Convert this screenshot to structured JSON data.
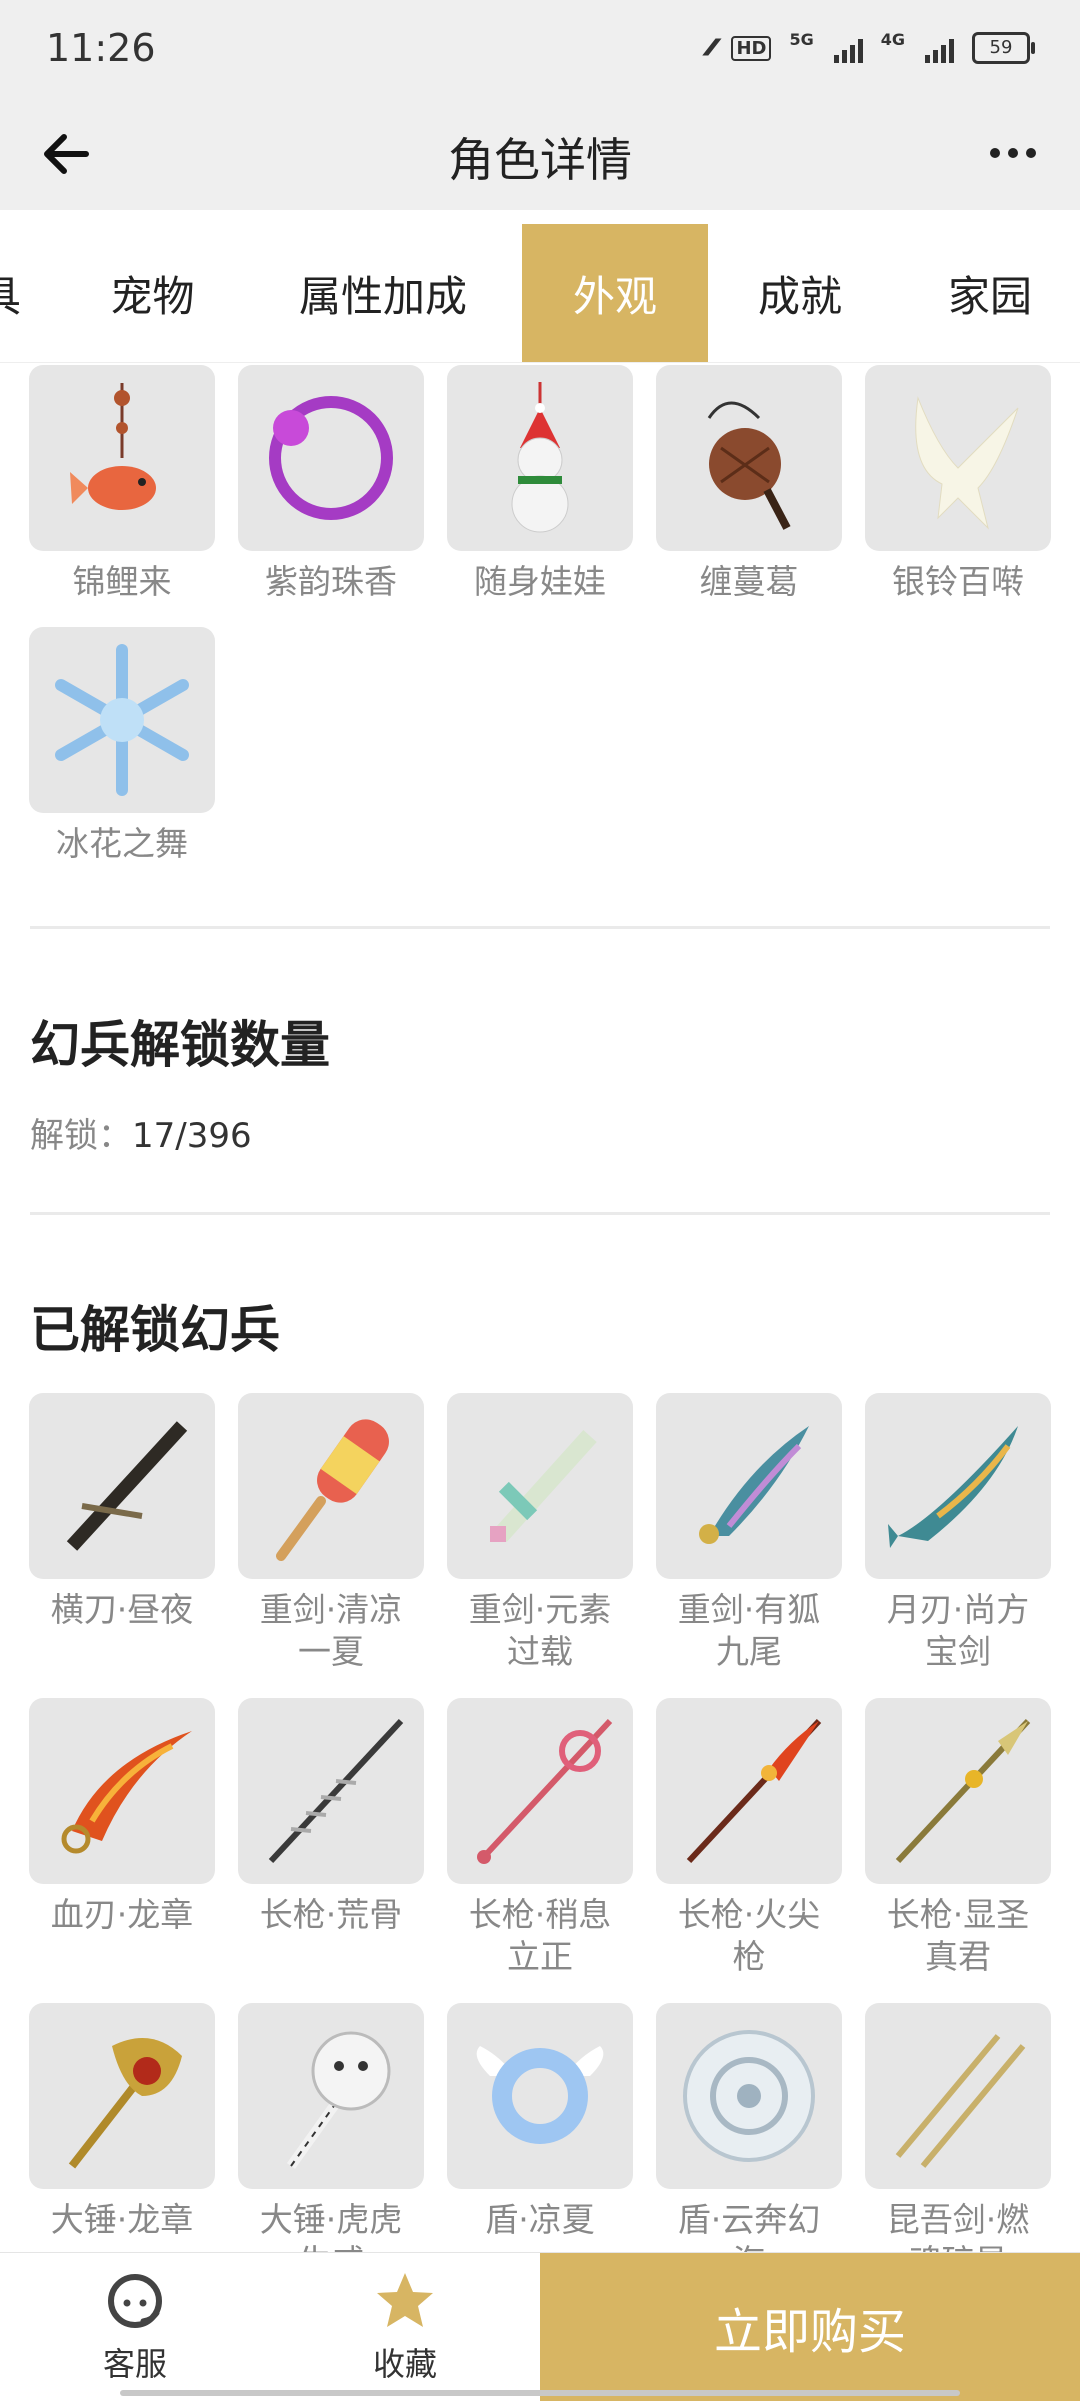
{
  "status": {
    "time": "11:26",
    "battery": "59",
    "net1": "5G",
    "net2": "4G",
    "hd": "HD"
  },
  "header": {
    "title": "角色详情"
  },
  "tabs": [
    {
      "label": "具",
      "active": false
    },
    {
      "label": "宠物",
      "active": false
    },
    {
      "label": "属性加成",
      "active": false
    },
    {
      "label": "外观",
      "active": true
    },
    {
      "label": "成就",
      "active": false
    },
    {
      "label": "家园",
      "active": false
    }
  ],
  "appearance_items": [
    {
      "name": "锦鲤来",
      "icon": "koi-pendant-icon"
    },
    {
      "name": "紫韵珠香",
      "icon": "purple-ring-icon"
    },
    {
      "name": "随身娃娃",
      "icon": "snowman-doll-icon"
    },
    {
      "name": "缠蔓葛",
      "icon": "gourd-icon"
    },
    {
      "name": "银铃百啭",
      "icon": "white-bird-icon"
    },
    {
      "name": "冰花之舞",
      "icon": "snowflake-icon"
    }
  ],
  "unlock_section": {
    "title": "幻兵解锁数量",
    "label": "解锁：",
    "value": "17/396"
  },
  "weapons_section": {
    "title": "已解锁幻兵"
  },
  "weapons": [
    {
      "line1": "横刀·昼夜",
      "line2": "",
      "icon": "dark-blade-icon"
    },
    {
      "line1": "重剑·清凉",
      "line2": "一夏",
      "icon": "popsicle-sword-icon"
    },
    {
      "line1": "重剑·元素",
      "line2": "过载",
      "icon": "pixel-sword-icon"
    },
    {
      "line1": "重剑·有狐",
      "line2": "九尾",
      "icon": "fox-tail-sword-icon"
    },
    {
      "line1": "月刃·尚方",
      "line2": "宝剑",
      "icon": "fish-blade-icon"
    },
    {
      "line1": "血刃·龙章",
      "line2": "",
      "icon": "fire-blade-icon"
    },
    {
      "line1": "长枪·荒骨",
      "line2": "",
      "icon": "bone-spear-icon"
    },
    {
      "line1": "长枪·稍息",
      "line2": "立正",
      "icon": "candy-spear-icon"
    },
    {
      "line1": "长枪·火尖",
      "line2": "枪",
      "icon": "fire-spear-icon"
    },
    {
      "line1": "长枪·显圣",
      "line2": "真君",
      "icon": "gold-spear-icon"
    },
    {
      "line1": "大锤·龙章",
      "line2": "",
      "icon": "dragon-hammer-icon"
    },
    {
      "line1": "大锤·虎虎",
      "line2": "生威",
      "icon": "tiger-hammer-icon"
    },
    {
      "line1": "盾·凉夏",
      "line2": "",
      "icon": "winged-ring-shield-icon"
    },
    {
      "line1": "盾·云奔幻",
      "line2": "海",
      "icon": "frost-shield-icon"
    },
    {
      "line1": "昆吾剑·燃",
      "line2": "魂碎星",
      "icon": "twin-swords-icon"
    }
  ],
  "bottom_bar": {
    "service": "客服",
    "favorite": "收藏",
    "buy": "立即购买"
  },
  "colors": {
    "accent": "#d7b563",
    "header_bg": "#efefef",
    "thumb_bg": "#e6e6e6",
    "label_gray": "#888888"
  }
}
